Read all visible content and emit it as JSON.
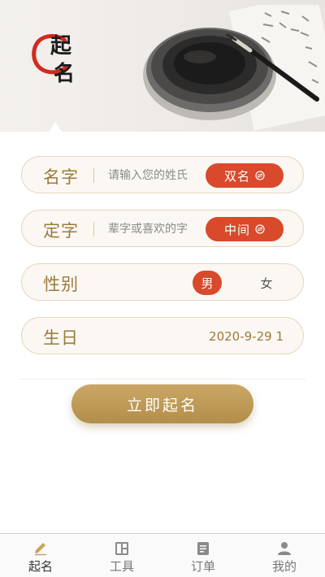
{
  "banner": {
    "logo_chars": [
      "起",
      "名"
    ]
  },
  "form": {
    "name": {
      "label": "名字",
      "placeholder": "请输入您的姓氏",
      "mode_button": "双名"
    },
    "char": {
      "label": "定字",
      "placeholder": "辈字或喜欢的字",
      "position_button": "中间"
    },
    "gender": {
      "label": "性别",
      "options": [
        "男",
        "女"
      ],
      "selected": "男"
    },
    "birth": {
      "label": "生日",
      "value": "2020-9-29 1"
    },
    "submit_label": "立即起名"
  },
  "tabbar": {
    "items": [
      {
        "label": "起名",
        "icon": "pen-icon",
        "active": true
      },
      {
        "label": "工具",
        "icon": "grid-icon",
        "active": false
      },
      {
        "label": "订单",
        "icon": "order-icon",
        "active": false
      },
      {
        "label": "我的",
        "icon": "user-icon",
        "active": false
      }
    ]
  },
  "colors": {
    "accent_red": "#d9492b",
    "gold": "#9b7a3c",
    "button_gold": "#b38e4a",
    "field_border": "#e5d7c0"
  }
}
